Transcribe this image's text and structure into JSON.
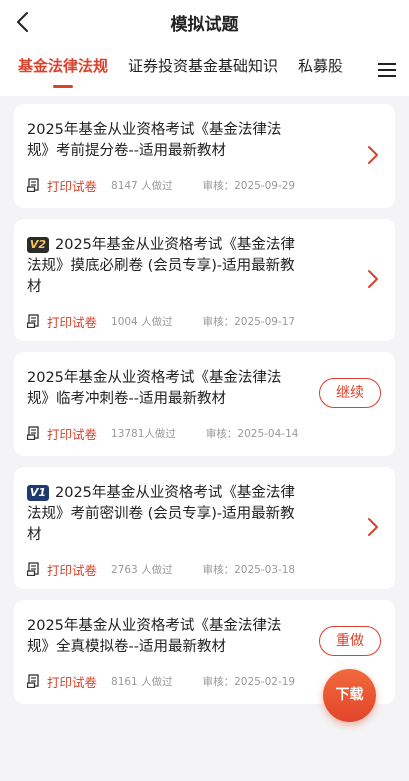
{
  "header": {
    "title": "模拟试题"
  },
  "tabs": [
    {
      "label": "基金法律法规",
      "active": true
    },
    {
      "label": "证券投资基金基础知识",
      "active": false
    },
    {
      "label": "私募股",
      "active": false
    }
  ],
  "icons": {
    "back": "chevron-left-icon",
    "menu": "hamburger-menu-icon",
    "print": "print-icon",
    "arrow": "chevron-right-icon"
  },
  "colors": {
    "accent": "#d9422c",
    "badge_dark": "#2b2b2b",
    "badge_blue": "#1f3a6e"
  },
  "papers": [
    {
      "title": "2025年基金从业资格考试《基金法律法规》考前提分卷--适用最新教材",
      "badge": "",
      "print_label": "打印试卷",
      "doers": "8147 人做过",
      "review": "审核：2025-09-29",
      "action": "chevron",
      "action_label": ""
    },
    {
      "title": "2025年基金从业资格考试《基金法律法规》摸底必刷卷 (会员专享)-适用最新教材",
      "badge": "V2",
      "print_label": "打印试卷",
      "doers": "1004 人做过",
      "review": "审核：2025-09-17",
      "action": "chevron",
      "action_label": ""
    },
    {
      "title": "2025年基金从业资格考试《基金法律法规》临考冲刺卷--适用最新教材",
      "badge": "",
      "print_label": "打印试卷",
      "doers": "13781人做过",
      "review": "审核：2025-04-14",
      "action": "button",
      "action_label": "继续"
    },
    {
      "title": "2025年基金从业资格考试《基金法律法规》考前密训卷 (会员专享)-适用最新教材",
      "badge": "V1",
      "print_label": "打印试卷",
      "doers": "2763 人做过",
      "review": "审核：2025-03-18",
      "action": "chevron",
      "action_label": ""
    },
    {
      "title": "2025年基金从业资格考试《基金法律法规》全真模拟卷--适用最新教材",
      "badge": "",
      "print_label": "打印试卷",
      "doers": "8161 人做过",
      "review": "审核：2025-02-19",
      "action": "button",
      "action_label": "重做"
    }
  ],
  "download": {
    "label": "下载"
  }
}
